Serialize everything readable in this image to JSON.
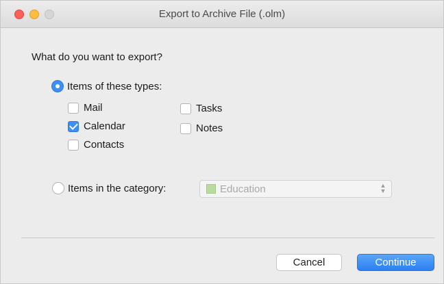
{
  "window": {
    "title": "Export to Archive File (.olm)"
  },
  "prompt": "What do you want to export?",
  "options": {
    "items_of_types": {
      "label": "Items of these types:",
      "selected": true
    },
    "types": {
      "mail": {
        "label": "Mail",
        "checked": false
      },
      "calendar": {
        "label": "Calendar",
        "checked": true
      },
      "contacts": {
        "label": "Contacts",
        "checked": false
      },
      "tasks": {
        "label": "Tasks",
        "checked": false
      },
      "notes": {
        "label": "Notes",
        "checked": false
      }
    },
    "items_in_category": {
      "label": "Items in the category:",
      "selected": false,
      "category_value": "Education",
      "category_color": "#b8dba0",
      "disabled": true
    }
  },
  "buttons": {
    "cancel": "Cancel",
    "continue": "Continue"
  },
  "colors": {
    "accent": "#3d8ff5"
  }
}
